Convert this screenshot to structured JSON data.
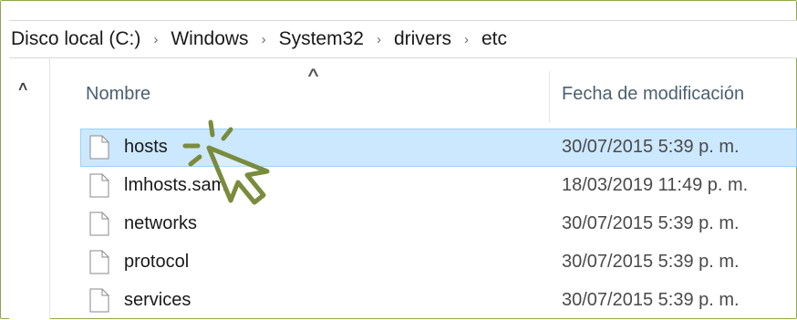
{
  "breadcrumb": [
    "Disco local (C:)",
    "Windows",
    "System32",
    "drivers",
    "etc"
  ],
  "columns": {
    "name": "Nombre",
    "date_modified": "Fecha de modificación"
  },
  "files": [
    {
      "name": "hosts",
      "date": "30/07/2015 5:39 p. m.",
      "selected": true
    },
    {
      "name": "lmhosts.sam",
      "date": "18/03/2019 11:49 p. m.",
      "selected": false
    },
    {
      "name": "networks",
      "date": "30/07/2015 5:39 p. m.",
      "selected": false
    },
    {
      "name": "protocol",
      "date": "30/07/2015 5:39 p. m.",
      "selected": false
    },
    {
      "name": "services",
      "date": "30/07/2015 5:39 p. m.",
      "selected": false
    }
  ],
  "icons": {
    "breadcrumb_separator": "chevron-right-icon",
    "nav_up": "chevron-up-icon",
    "sort": "sort-ascending-icon",
    "file": "file-icon",
    "pointer": "click-pointer-icon"
  },
  "colors": {
    "selection_bg": "#cce8ff",
    "selection_border": "#99d1ff",
    "frame_border": "#8fa84a",
    "pointer_stroke": "#7a8c3c"
  }
}
